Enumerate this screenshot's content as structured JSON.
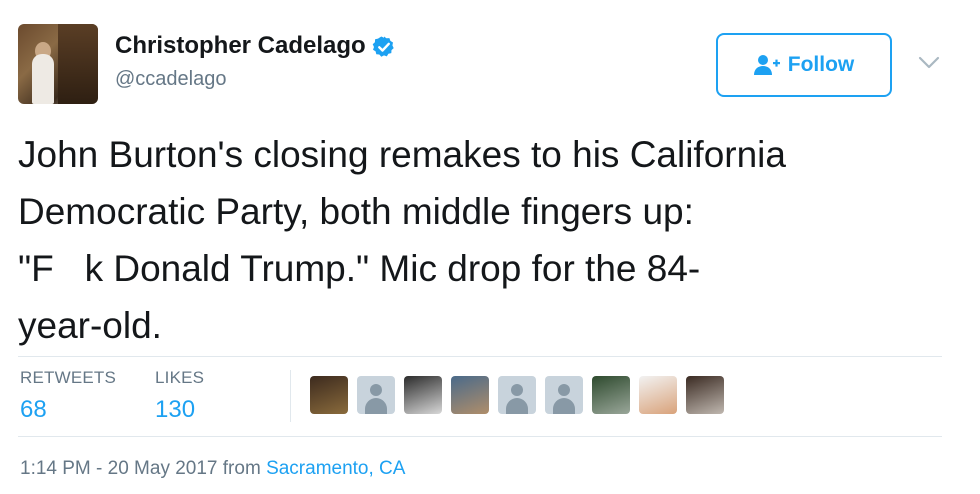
{
  "author": {
    "name": "Christopher Cadelago",
    "handle": "@ccadelago",
    "verified": true
  },
  "follow_button": {
    "label": "Follow",
    "icon": "add-user-icon"
  },
  "tweet": {
    "text": "John Burton's closing remakes to his California\nDemocratic Party, both middle fingers up:\n\"F   k Donald Trump.\" Mic drop for the 84-\nyear-old."
  },
  "stats": {
    "retweets_label": "RETWEETS",
    "retweets_value": "68",
    "likes_label": "LIKES",
    "likes_value": "130"
  },
  "liker_avatars": [
    {
      "kind": "photo",
      "colors": [
        "#3c2a1e",
        "#8a6b3c"
      ]
    },
    {
      "kind": "default"
    },
    {
      "kind": "photo",
      "colors": [
        "#2b2b2b",
        "#d8d8d8"
      ]
    },
    {
      "kind": "photo",
      "colors": [
        "#4a6a8a",
        "#b08e6a"
      ]
    },
    {
      "kind": "default"
    },
    {
      "kind": "default"
    },
    {
      "kind": "photo",
      "colors": [
        "#2e4a2e",
        "#9aa79a"
      ]
    },
    {
      "kind": "photo",
      "colors": [
        "#f2f2f2",
        "#d9a27a"
      ]
    },
    {
      "kind": "photo",
      "colors": [
        "#3a2a22",
        "#c0b8b0"
      ]
    }
  ],
  "meta": {
    "time": "1:14 PM - 20 May 2017 from ",
    "location": "Sacramento, CA"
  },
  "colors": {
    "accent": "#1da1f2",
    "muted": "#657786",
    "text": "#14171a",
    "divider": "#e1e8ed"
  }
}
